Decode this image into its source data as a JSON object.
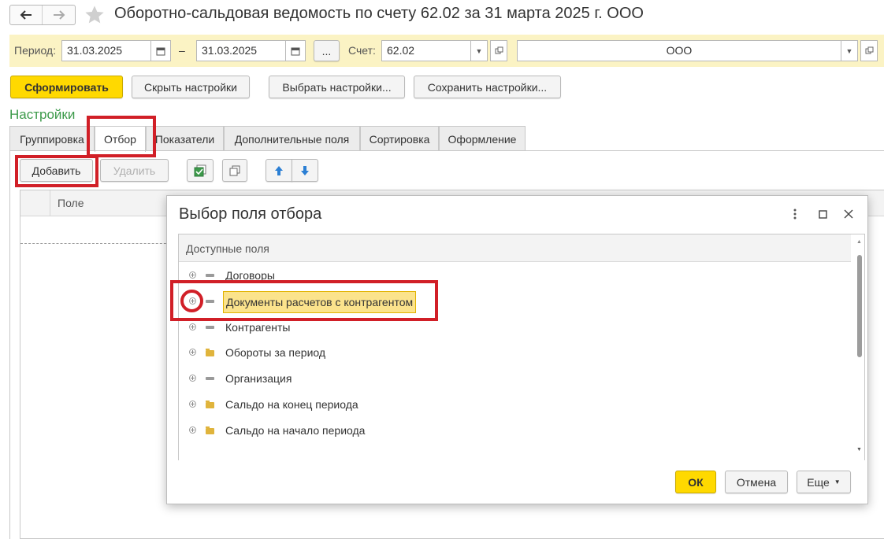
{
  "window": {
    "title": "Оборотно-сальдовая ведомость по счету 62.02 за 31 марта 2025 г. ООО",
    "back_icon": "arrow-left-icon",
    "forward_icon": "arrow-right-icon",
    "favorite_icon": "star-icon"
  },
  "params": {
    "period_label": "Период:",
    "period_from": "31.03.2025",
    "dash": "–",
    "period_to": "31.03.2025",
    "more_btn": "...",
    "account_label": "Счет:",
    "account_value": "62.02",
    "org_value": "ООО"
  },
  "toolbar": {
    "generate": "Сформировать",
    "hide_settings": "Скрыть настройки",
    "choose_settings": "Выбрать настройки...",
    "save_settings": "Сохранить настройки..."
  },
  "settings": {
    "title": "Настройки",
    "tabs": [
      "Группировка",
      "Отбор",
      "Показатели",
      "Дополнительные поля",
      "Сортировка",
      "Оформление"
    ],
    "active_tab": "Отбор",
    "add_button": "Добавить",
    "delete_button": "Удалить",
    "column_field": "Поле"
  },
  "dialog": {
    "title": "Выбор поля отбора",
    "header": "Доступные поля",
    "items": [
      {
        "label": "Договоры",
        "icon": "attribute-icon"
      },
      {
        "label": "Документы расчетов с контрагентом",
        "icon": "attribute-icon",
        "selected": true
      },
      {
        "label": "Контрагенты",
        "icon": "attribute-icon"
      },
      {
        "label": "Обороты за период",
        "icon": "folder-icon"
      },
      {
        "label": "Организация",
        "icon": "attribute-icon"
      },
      {
        "label": "Сальдо на конец периода",
        "icon": "folder-icon"
      },
      {
        "label": "Сальдо на начало периода",
        "icon": "folder-icon"
      }
    ],
    "ok": "ОК",
    "cancel": "Отмена",
    "more": "Еще"
  },
  "colors": {
    "accent_yellow": "#ffd900",
    "highlight_red": "#d11f27",
    "settings_green": "#3c9a4a",
    "param_bar": "#fbf3c4"
  }
}
